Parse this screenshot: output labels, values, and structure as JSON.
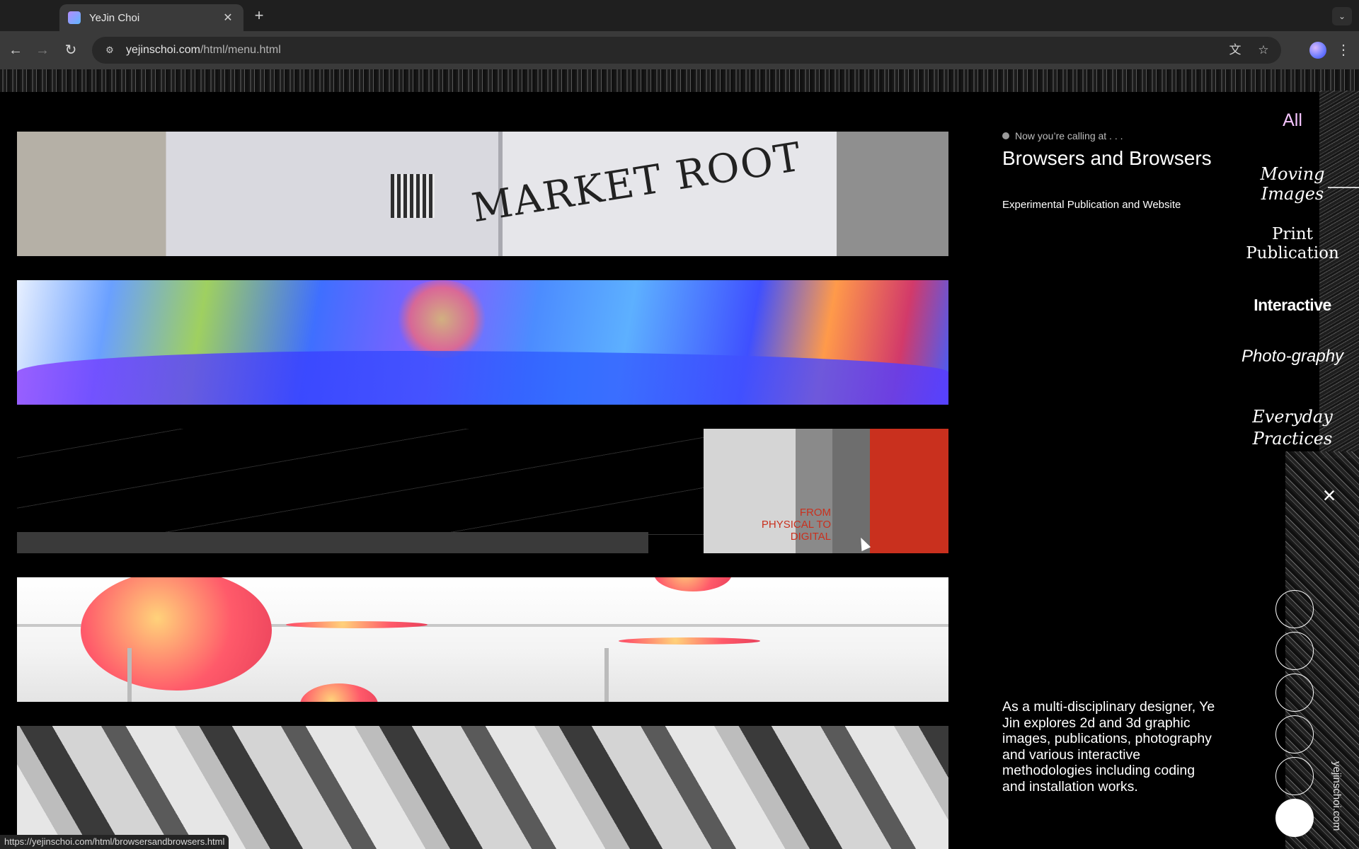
{
  "browser": {
    "tab_title": "YeJin Choi",
    "url_domain": "yejinschoi.com",
    "url_path": "/html/menu.html",
    "status_url": "https://yejinschoi.com/html/browsersandbrowsers.html"
  },
  "info": {
    "calling_label": "Now you’re calling at . . .",
    "title": "Browsers and Browsers",
    "subtitle": "Experimental Publication and Website",
    "bio": "As a multi-disciplinary designer, Ye Jin explores 2d and 3d graphic images, publications, photography and various interactive methodologies including coding and installation works."
  },
  "thumbs": {
    "t1_text": "MARKET ROOT",
    "t3_text": "FROM PHYSICAL TO DIGITAL"
  },
  "nav": {
    "all": "All",
    "moving_images": "Moving Images",
    "print_publication": "Print Publication",
    "interactive": "Interactive",
    "photography": "Photo-graphy",
    "everyday_practices": "Everyday Practices",
    "close": "×"
  },
  "pager": {
    "count": 6,
    "active_index": 5
  },
  "vertical_label": "yejinschoi.com",
  "colors": {
    "accent_all": "#f6c5ff",
    "page_bg": "#000000"
  }
}
